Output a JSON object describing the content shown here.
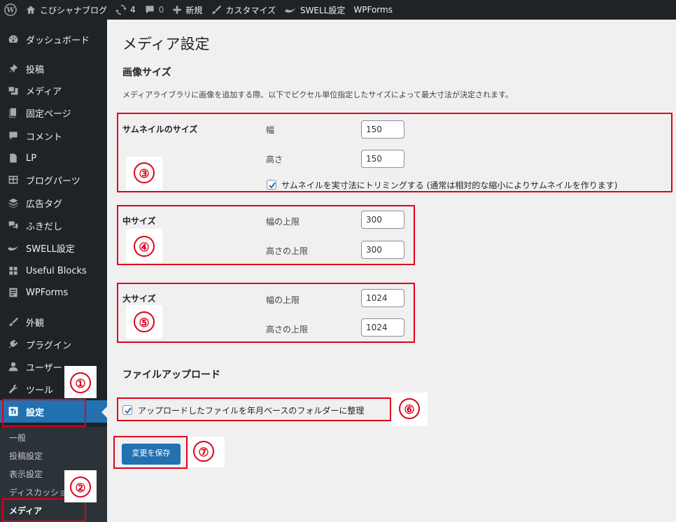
{
  "adminbar": {
    "site_name": "こびシャナブログ",
    "updates_count": "4",
    "comments_count": "0",
    "new_label": "新規",
    "customize_label": "カスタマイズ",
    "swell_label": "SWELL設定",
    "wpforms_label": "WPForms"
  },
  "sidebar": {
    "items": [
      {
        "label": "ダッシュボード",
        "icon": "dashboard-icon"
      },
      {
        "label": "投稿",
        "icon": "pin-icon"
      },
      {
        "label": "メディア",
        "icon": "media-icon"
      },
      {
        "label": "固定ページ",
        "icon": "page-icon"
      },
      {
        "label": "コメント",
        "icon": "comment-icon"
      },
      {
        "label": "LP",
        "icon": "document-icon"
      },
      {
        "label": "ブログパーツ",
        "icon": "grid-icon"
      },
      {
        "label": "広告タグ",
        "icon": "stack-icon"
      },
      {
        "label": "ふきだし",
        "icon": "speech-icon"
      },
      {
        "label": "SWELL設定",
        "icon": "swell-icon"
      },
      {
        "label": "Useful Blocks",
        "icon": "blocks-icon"
      },
      {
        "label": "WPForms",
        "icon": "form-icon"
      },
      {
        "label": "外観",
        "icon": "brush-icon"
      },
      {
        "label": "プラグイン",
        "icon": "plugin-icon"
      },
      {
        "label": "ユーザー",
        "icon": "user-icon"
      },
      {
        "label": "ツール",
        "icon": "wrench-icon"
      },
      {
        "label": "設定",
        "icon": "settings-icon"
      }
    ],
    "submenu": [
      "一般",
      "投稿設定",
      "表示設定",
      "ディスカッション",
      "メディア"
    ]
  },
  "page": {
    "title": "メディア設定",
    "image_sizes_heading": "画像サイズ",
    "description": "メディアライブラリに画像を追加する際、以下でピクセル単位指定したサイズによって最大寸法が決定されます。",
    "thumbnail": {
      "label": "サムネイルのサイズ",
      "width_label": "幅",
      "width_value": "150",
      "height_label": "高さ",
      "height_value": "150",
      "crop_label": "サムネイルを実寸法にトリミングする (通常は相対的な縮小によりサムネイルを作ります)",
      "crop_checked": true
    },
    "medium": {
      "label": "中サイズ",
      "width_label": "幅の上限",
      "width_value": "300",
      "height_label": "高さの上限",
      "height_value": "300"
    },
    "large": {
      "label": "大サイズ",
      "width_label": "幅の上限",
      "width_value": "1024",
      "height_label": "高さの上限",
      "height_value": "1024"
    },
    "uploads_heading": "ファイルアップロード",
    "uploads_label": "アップロードしたファイルを年月ベースのフォルダーに整理",
    "uploads_checked": true,
    "save_label": "変更を保存"
  },
  "annotations": {
    "n1": "①",
    "n2": "②",
    "n3": "③",
    "n4": "④",
    "n5": "⑤",
    "n6": "⑥",
    "n7": "⑦",
    "color": "#e0001b"
  },
  "colors": {
    "adminbar": "#1d2327",
    "sidebar": "#1d2327",
    "active": "#2271b1",
    "content_bg": "#f0f0f1"
  }
}
